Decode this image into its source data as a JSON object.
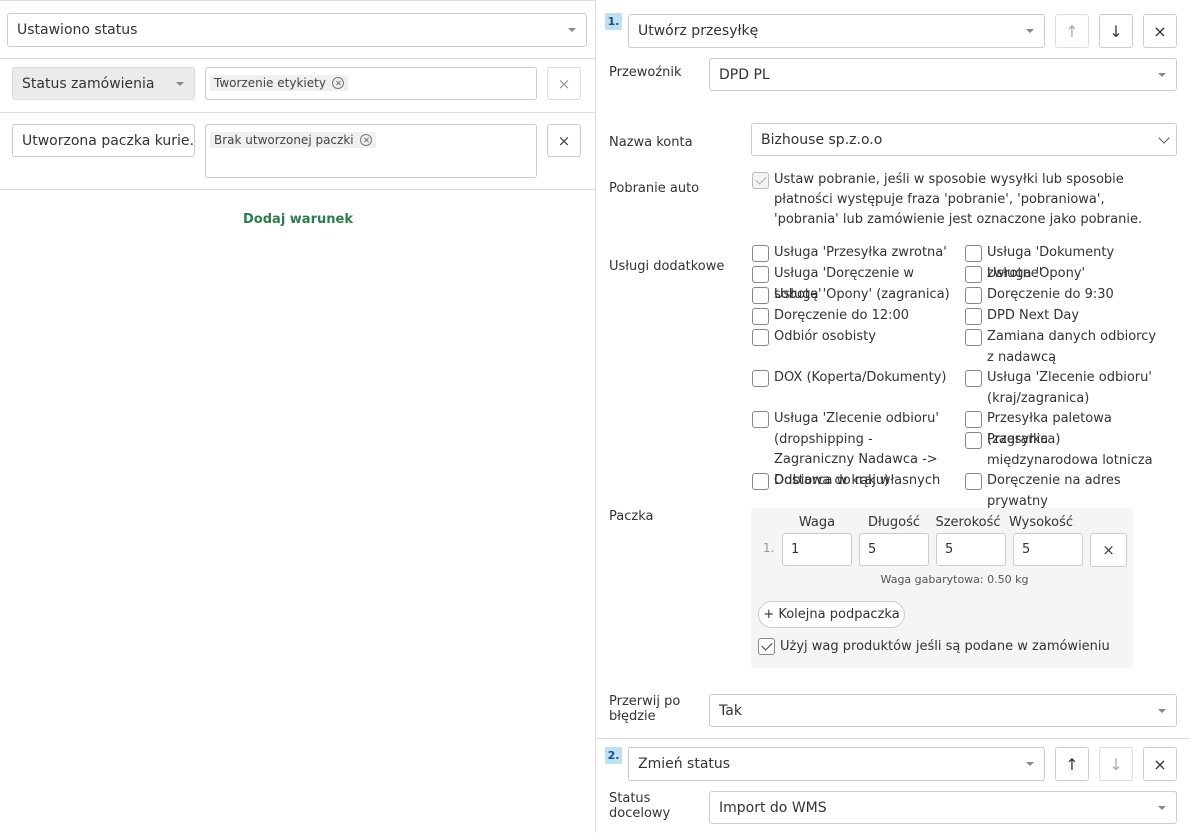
{
  "left": {
    "trigger": {
      "value": "Ustawiono status"
    },
    "condition1": {
      "field": "Status zamówienia",
      "tag": "Tworzenie etykiety"
    },
    "condition2": {
      "field": "Utworzona paczka kurie…",
      "tag": "Brak utworzonej paczki"
    },
    "add_condition_label": "Dodaj warunek",
    "remove_label": "×"
  },
  "action1": {
    "number": "1.",
    "type": "Utwórz przesyłkę",
    "up_arrow": "↑",
    "down_arrow": "↓",
    "close": "×",
    "carrier_label": "Przewoźnik",
    "carrier_value": "DPD PL",
    "account_label": "Nazwa konta",
    "account_value": "Bizhouse sp.z.o.o",
    "cod_label": "Pobranie auto",
    "cod_text": "Ustaw pobranie, jeśli w sposobie wysyłki lub sposobie płatności występuje fraza 'pobranie', 'pobraniowa', 'pobrania' lub zamówienie jest oznaczone jako pobranie.",
    "services_label": "Usługi dodatkowe",
    "services_left": [
      "Usługa 'Przesyłka zwrotna'",
      "Usługa 'Doręczenie w sobotę'",
      "Usługa 'Opony' (zagranica)",
      "Doręczenie do 12:00",
      "Odbiór osobisty",
      "DOX (Koperta/Dokumenty)",
      "Usługa 'Zlecenie odbioru' (dropshipping - Zagraniczny Nadawca -> Odbiorca w kraju)",
      "Dostawa do rąk własnych"
    ],
    "services_right": [
      "Usługa 'Dokumenty zwrotne'",
      "Usługa 'Opony'",
      "Doręczenie do 9:30",
      "DPD Next Day",
      "Zamiana danych odbiorcy z nadawcą",
      "Usługa 'Zlecenie odbioru' (kraj/zagranica)",
      "Przesyłka paletowa (zagranica)",
      "Przesyłka międzynarodowa lotnicza",
      "Doręczenie na adres prywatny"
    ],
    "package_label": "Paczka",
    "package": {
      "col_weight": "Waga",
      "col_length": "Długość",
      "col_width": "Szerokość",
      "col_height": "Wysokość",
      "row_num": "1.",
      "weight": "1",
      "length": "5",
      "width": "5",
      "height": "5",
      "dim_weight_text": "Waga gabarytowa: 0.50 kg",
      "add_subpackage": "+ Kolejna podpaczka",
      "use_product_weights": "Użyj wag produktów jeśli są podane w zamówieniu"
    },
    "stop_label": "Przerwij po błędzie",
    "stop_value": "Tak"
  },
  "action2": {
    "number": "2.",
    "type": "Zmień status",
    "up_arrow": "↑",
    "down_arrow": "↓",
    "close": "×",
    "target_label": "Status docelowy",
    "target_value": "Import do WMS"
  },
  "colors": {
    "link_green": "#2e7d4f",
    "badge_blue": "#bde0f5"
  }
}
